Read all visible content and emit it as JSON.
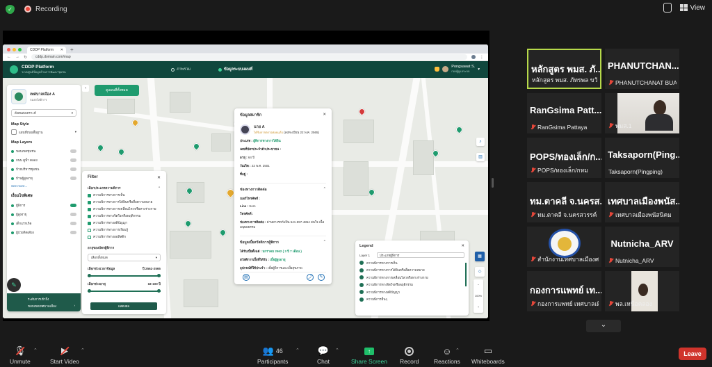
{
  "topbar": {
    "recording_label": "Recording",
    "view_label": "View"
  },
  "browser": {
    "tab_title": "CDDP Platform",
    "url": "cddp.domain.com/map"
  },
  "app": {
    "brand_title": "CDDP Platform",
    "brand_sub": "ระบบศูนย์ข้อมูลด้านการพัฒนาชุมชน",
    "nav": [
      "ภาพรวม",
      "ข้อมูลระบบแผนที่"
    ],
    "user_name": "Pongsawat S.",
    "user_sub": "กองผู้ดูแลระบบ"
  },
  "left_panel": {
    "org_name": "เทศบาลเมือง A",
    "org_sub": "กองสวัสดิการ",
    "select_value": "สังคมสงเคราะห์",
    "map_style_title": "Map Style",
    "map_style_value": "แผนที่ถนนพื้นฐาน",
    "map_layers_title": "Map Layers",
    "layers": [
      "ขอบเขตชุมชน",
      "ถนน คูน้ำ คลอง",
      "ป้ายบริหารชุมชน",
      "บ้านผู้สูงอายุ"
    ],
    "see_more": "See more...",
    "filter_title": "เงื่อนไขพิเศษ",
    "toggles": [
      "ผู้พิการ",
      "ผู้สูงอายุ",
      "เด็กแรกเกิด",
      "ผู้ป่วยติดเตียง"
    ],
    "bottom_line1": "ระดับการเข้าถึง",
    "bottom_line2": "ขอบเขตเทศบาลเมือง"
  },
  "reset_button": "ดูแผนที่ทั้งหมด",
  "filter": {
    "title": "Filter",
    "section1": "เลือกประเภทความพิการ",
    "options": [
      {
        "label": "ความพิการทางการเห็น",
        "checked": true
      },
      {
        "label": "ความพิการทางการได้ยินหรือสื่อความหมาย",
        "checked": true
      },
      {
        "label": "ความพิการทางการเคลื่อนไหวหรือทางร่างกาย",
        "checked": true
      },
      {
        "label": "ความพิการทางจิตใจหรือพฤติกรรม",
        "checked": true
      },
      {
        "label": "ความพิการทางสติปัญญา",
        "checked": true
      },
      {
        "label": "ความพิการทางการเรียนรู้",
        "checked": false
      },
      {
        "label": "ความพิการทางออทิสติก",
        "checked": false
      }
    ],
    "section2": "อายุของบัตรผู้พิการ",
    "section2_value": "เลือกทั้งหมด",
    "range1_label": "เลือกช่วงเวลาข้อมูล",
    "range1_value": "ปี 2562-2565",
    "range2_label": "เลือกช่วงอายุ",
    "range2_value": "18-100 ปี",
    "button": "แสดงผล"
  },
  "card": {
    "title": "ข้อมูลสมาชิก",
    "name": "นาย A",
    "badge": "ได้รับการตรวจสอบแล้ว",
    "badge_date": "(ลงทะเบียน 22 พ.ค. 2565)",
    "rows": [
      {
        "k": "ประเภท :",
        "v": "ผู้พิการทางการได้ยิน"
      },
      {
        "k": "เลขที่บัตรประจำตัวประชาชน :",
        "v": ""
      },
      {
        "k": "อายุ :",
        "v": "64 ปี"
      },
      {
        "k": "วันเกิด :",
        "v": "22 พ.ค. 2501"
      },
      {
        "k": "ที่อยู่ :",
        "v": ""
      }
    ],
    "contact_title": "ช่องทางการติดต่อ",
    "contact_rows": [
      {
        "k": "เบอร์โทรศัพท์ :",
        "v": ""
      },
      {
        "k": "Line :",
        "v": "Som"
      },
      {
        "k": "โทรศัพท์ :",
        "v": ""
      },
      {
        "k": "ช่องทางการติดต่อ :",
        "v": "ผ่านทางรถกัมปิน 541-897-4854 สนใจ เนื้อมนุษยธรรม"
      }
    ],
    "benefit_title": "ข้อมูลเบี้ยสวัสดิการผู้พิการ",
    "benefit_rows": [
      {
        "k": "ได้รับเบี้ยตั้งแต่ :",
        "v": "มกราคม 2562 ( 3 ปี 7 เดือน )"
      },
      {
        "k": "สวัสดิการเบี้ยที่ได้รับ :",
        "v": "เบี้ยผู้สูงอายุ"
      },
      {
        "k": "อุปกรณ์ที่ใช้ประจำ :",
        "v": "เบี้ยผู้พิการและเบี้ยสุขภาพ"
      }
    ]
  },
  "legend": {
    "title": "Legend",
    "layer_label": "Layer 1",
    "layer_value": "ประเภทผู้พิการ",
    "items": [
      "ความพิการทางการเห็น",
      "ความพิการทางการได้ยินหรือสื่อความหมาย",
      "ความพิการทางการเคลื่อนไหวหรือทางร่างกาย",
      "ความพิการทางจิตใจหรือพฤติกรรม",
      "ความพิการทางสติปัญญา",
      "ความพิการอื่นๆ"
    ]
  },
  "zoom_label": "100%",
  "participants": [
    {
      "big": "หลักสูตร พมส. ภั...",
      "cap": "หลักสูตร พมส. ภัทรพล ขวัญสุข",
      "muted": false,
      "active": true
    },
    {
      "big": "PHANUTCHAN...",
      "cap": "PHANUTCHANAT BUA...",
      "muted": true
    },
    {
      "big": "RanGsima  Patt...",
      "cap": "RanGsima  Pattaya",
      "muted": true
    },
    {
      "big": "",
      "cap": "พมส.1",
      "muted": true,
      "video": true
    },
    {
      "big": "POPS/ทองเล็ก/ก...",
      "cap": "POPS/ทองเล็ก/กหม",
      "muted": true
    },
    {
      "big": "Taksaporn(Ping...",
      "cap": "Taksaporn(Pingping)",
      "muted": false
    },
    {
      "big": "ทม.ตาคลี จ.นครส...",
      "cap": "ทม.ตาคลี จ.นครสวรรค์",
      "muted": true
    },
    {
      "big": "เทศบาลเมืองพนัส...",
      "cap": "เทศบาลเมืองพนัสนิคม",
      "muted": true
    },
    {
      "big": "",
      "cap": "สำนักงานเทศบาลเมืองศรีส...",
      "muted": true,
      "logo": true
    },
    {
      "big": "Nutnicha_ARV",
      "cap": "Nutnicha_ARV",
      "muted": true
    },
    {
      "big": "กองการแพทย์ เท...",
      "cap": "กองการแพทย์ เทศบาลเมือ...",
      "muted": true
    },
    {
      "big": "",
      "cap": "พล.เหนือคลอง",
      "muted": true,
      "video2": true
    }
  ],
  "toolbar": {
    "unmute": "Unmute",
    "start_video": "Start Video",
    "participants": "Participants",
    "participants_count": "46",
    "chat": "Chat",
    "share_screen": "Share Screen",
    "record": "Record",
    "reactions": "Reactions",
    "whiteboards": "Whiteboards",
    "leave": "Leave"
  }
}
